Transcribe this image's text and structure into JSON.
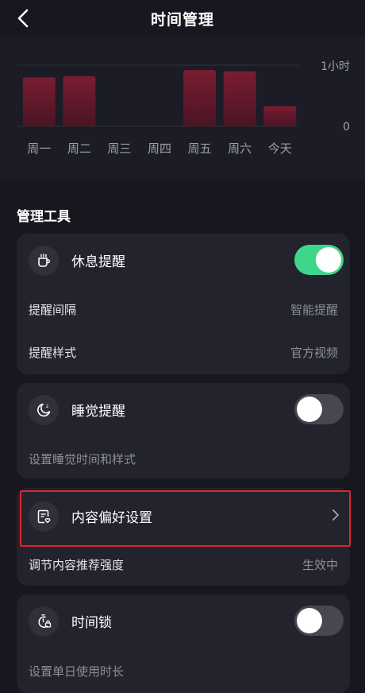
{
  "header": {
    "title": "时间管理"
  },
  "chart_data": {
    "type": "bar",
    "categories": [
      "周一",
      "周二",
      "周三",
      "周四",
      "周五",
      "周六",
      "今天"
    ],
    "values": [
      0.8,
      0.82,
      0,
      0,
      0.92,
      0.9,
      0.33
    ],
    "ylim": [
      0,
      1
    ],
    "ytick_labels": [
      "1小时",
      "0"
    ],
    "xlabel": "",
    "ylabel": "",
    "grid": true,
    "colors": {
      "bar_top": "#7a1c32",
      "bar_bottom": "#4a1524",
      "grid": "#30313a"
    }
  },
  "section": {
    "title": "管理工具"
  },
  "rest_card": {
    "label": "休息提醒",
    "icon": "cup-icon",
    "enabled": true,
    "rows": [
      {
        "label": "提醒间隔",
        "value": "智能提醒"
      },
      {
        "label": "提醒样式",
        "value": "官方视频"
      }
    ]
  },
  "sleep_card": {
    "label": "睡觉提醒",
    "icon": "moon-icon",
    "enabled": false,
    "sub": "设置睡觉时间和样式"
  },
  "content_card": {
    "label": "内容偏好设置",
    "icon": "document-heart-icon",
    "sub_label": "调节内容推荐强度",
    "sub_value": "生效中"
  },
  "lock_card": {
    "label": "时间锁",
    "icon": "timer-lock-icon",
    "enabled": false,
    "sub": "设置单日使用时长"
  },
  "colors": {
    "toggle_on": "#3ed68a",
    "toggle_off": "#46474f",
    "highlight": "#e3242b"
  }
}
